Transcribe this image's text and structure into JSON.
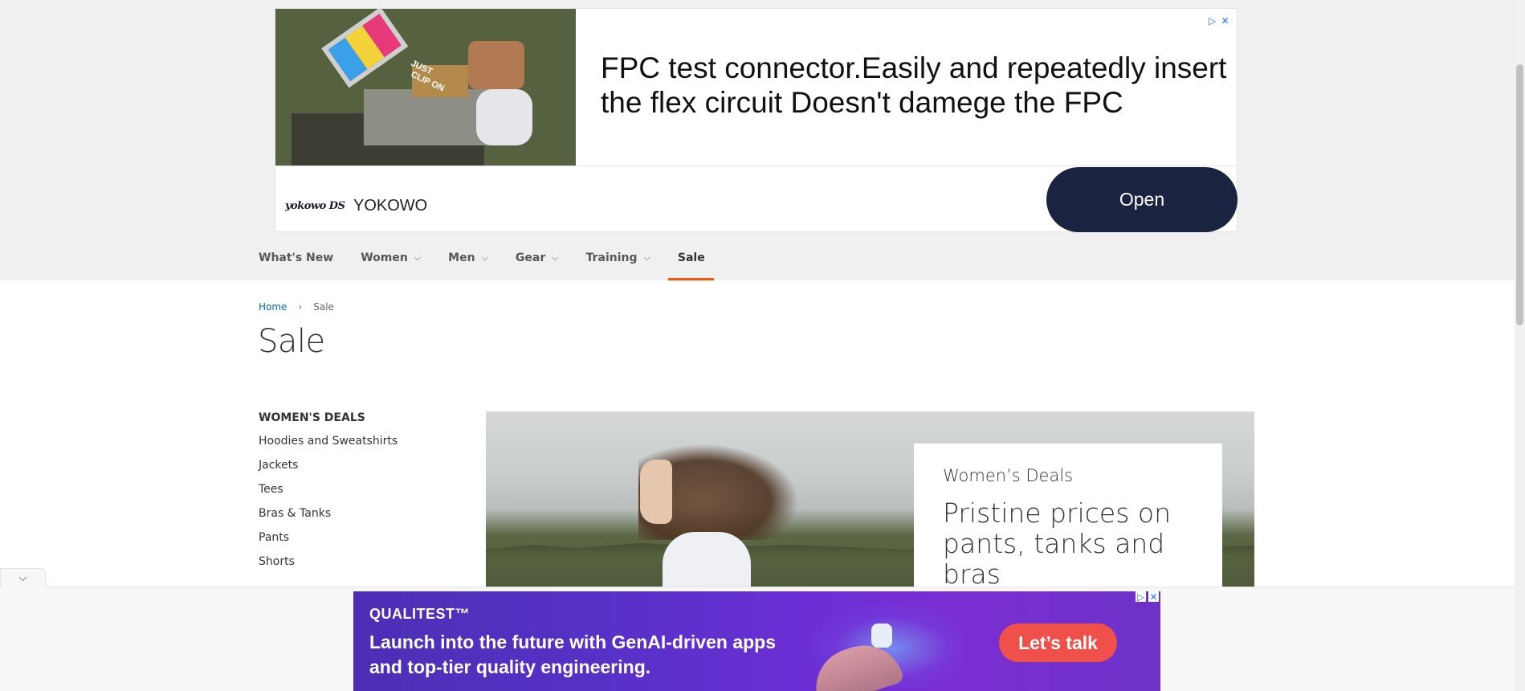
{
  "top_ad": {
    "headline": "FPC test connector.Easily and repeatedly insert the flex circuit Doesn't damege the FPC",
    "image_caption": "JUST CLIP ON",
    "brand_logo": "yokowo DS",
    "brand_name": "YOKOWO",
    "cta_label": "Open",
    "adchoices_icon": "play-triangle-icon",
    "close_icon": "close-icon",
    "cta_color": "#1a2340"
  },
  "nav": {
    "items": [
      {
        "label": "What's New",
        "has_dropdown": false,
        "active": false
      },
      {
        "label": "Women",
        "has_dropdown": true,
        "active": false
      },
      {
        "label": "Men",
        "has_dropdown": true,
        "active": false
      },
      {
        "label": "Gear",
        "has_dropdown": true,
        "active": false
      },
      {
        "label": "Training",
        "has_dropdown": true,
        "active": false
      },
      {
        "label": "Sale",
        "has_dropdown": false,
        "active": true
      }
    ],
    "active_color": "#ff5501"
  },
  "breadcrumb": {
    "home": "Home",
    "current": "Sale"
  },
  "page_title": "Sale",
  "sidebar": {
    "heading": "WOMEN'S DEALS",
    "items": [
      "Hoodies and Sweatshirts",
      "Jackets",
      "Tees",
      "Bras & Tanks",
      "Pants",
      "Shorts"
    ]
  },
  "hero": {
    "label": "Women’s Deals",
    "headline": "Pristine prices on pants, tanks and bras"
  },
  "bottom_ad": {
    "brand": "QUALITEST™",
    "copy": "Launch into the future with GenAI-driven apps and top-tier quality engineering.",
    "cta_label": "Let’s talk",
    "cta_color": "#f0504a"
  },
  "collapse_toggle_icon": "chevron-down-icon"
}
